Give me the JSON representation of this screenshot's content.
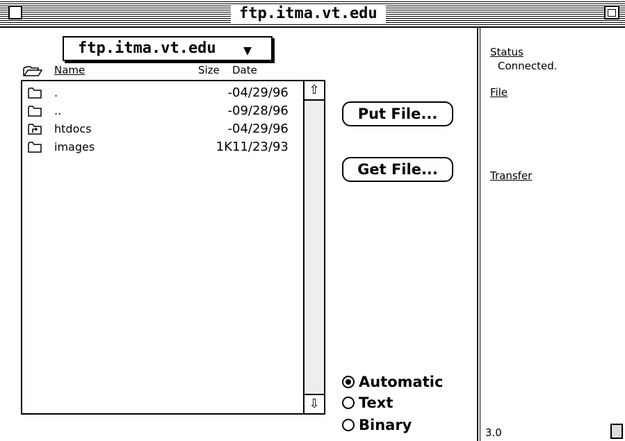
{
  "window": {
    "title": "ftp.itma.vt.edu"
  },
  "host_popup": {
    "label": "ftp.itma.vt.edu",
    "arrow": "▼"
  },
  "columns": {
    "name": "Name",
    "size": "Size",
    "date": "Date"
  },
  "files": [
    {
      "name": ".",
      "size": "-",
      "date": "04/29/96",
      "icon": "folder-icon"
    },
    {
      "name": "..",
      "size": "-",
      "date": "09/28/96",
      "icon": "folder-icon"
    },
    {
      "name": "htdocs",
      "size": "-",
      "date": "04/29/96",
      "icon": "alias-folder-icon"
    },
    {
      "name": "images",
      "size": "1K",
      "date": "11/23/93",
      "icon": "folder-icon"
    }
  ],
  "scroll": {
    "up_arrow": "⇧",
    "down_arrow": "⇩"
  },
  "buttons": {
    "put_file": "Put File...",
    "get_file": "Get File..."
  },
  "transfer_mode": {
    "options": [
      "Automatic",
      "Text",
      "Binary"
    ],
    "selected": "Automatic"
  },
  "side_panel": {
    "status_label": "Status",
    "status_value": "Connected.",
    "file_label": "File",
    "transfer_label": "Transfer",
    "version": "3.0"
  }
}
